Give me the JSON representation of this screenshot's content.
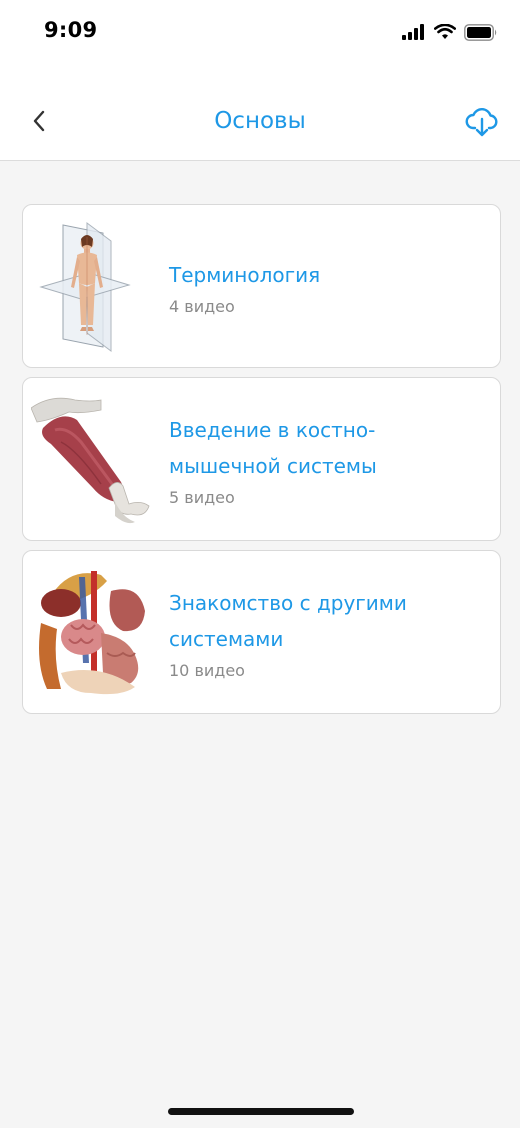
{
  "status_bar": {
    "time": "9:09",
    "icons": [
      "cellular-signal-icon",
      "wifi-icon",
      "battery-icon"
    ]
  },
  "header": {
    "title": "Основы",
    "back_icon": "chevron-left-icon",
    "download_icon": "cloud-download-icon"
  },
  "colors": {
    "accent": "#1e98e6",
    "subtitle": "#8a8a8a",
    "background": "#f5f5f5"
  },
  "courses": [
    {
      "title": "Терминология",
      "subtitle": "4 видео",
      "thumbnail": "human-body-planes-image"
    },
    {
      "title": "Введение в костно-мышечной системы",
      "subtitle": "5 видео",
      "thumbnail": "arm-muscle-image"
    },
    {
      "title": "Знакомство с другими системами",
      "subtitle": "10 видео",
      "thumbnail": "internal-organs-image"
    }
  ]
}
